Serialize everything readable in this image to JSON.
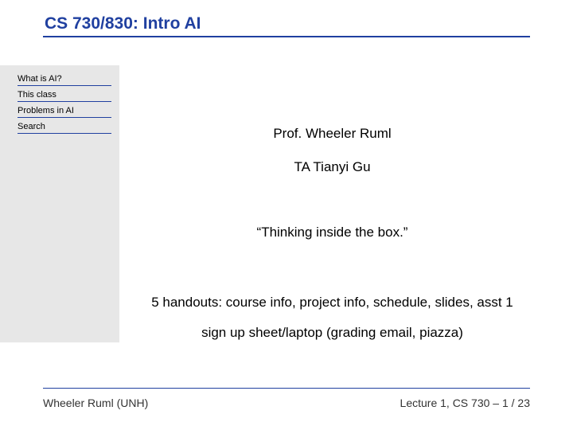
{
  "header": {
    "title": "CS 730/830: Intro AI"
  },
  "sidebar": {
    "items": [
      {
        "label": "What is AI?"
      },
      {
        "label": "This class"
      },
      {
        "label": "Problems in AI"
      },
      {
        "label": "Search"
      }
    ]
  },
  "content": {
    "professor": "Prof. Wheeler Ruml",
    "ta": "TA Tianyi Gu",
    "quote": "“Thinking inside the box.”",
    "handouts": "5 handouts: course info, project info, schedule, slides, asst 1",
    "signup": "sign up sheet/laptop (grading email, piazza)"
  },
  "footer": {
    "left": "Wheeler Ruml (UNH)",
    "right": "Lecture 1, CS 730 – 1 / 23"
  }
}
